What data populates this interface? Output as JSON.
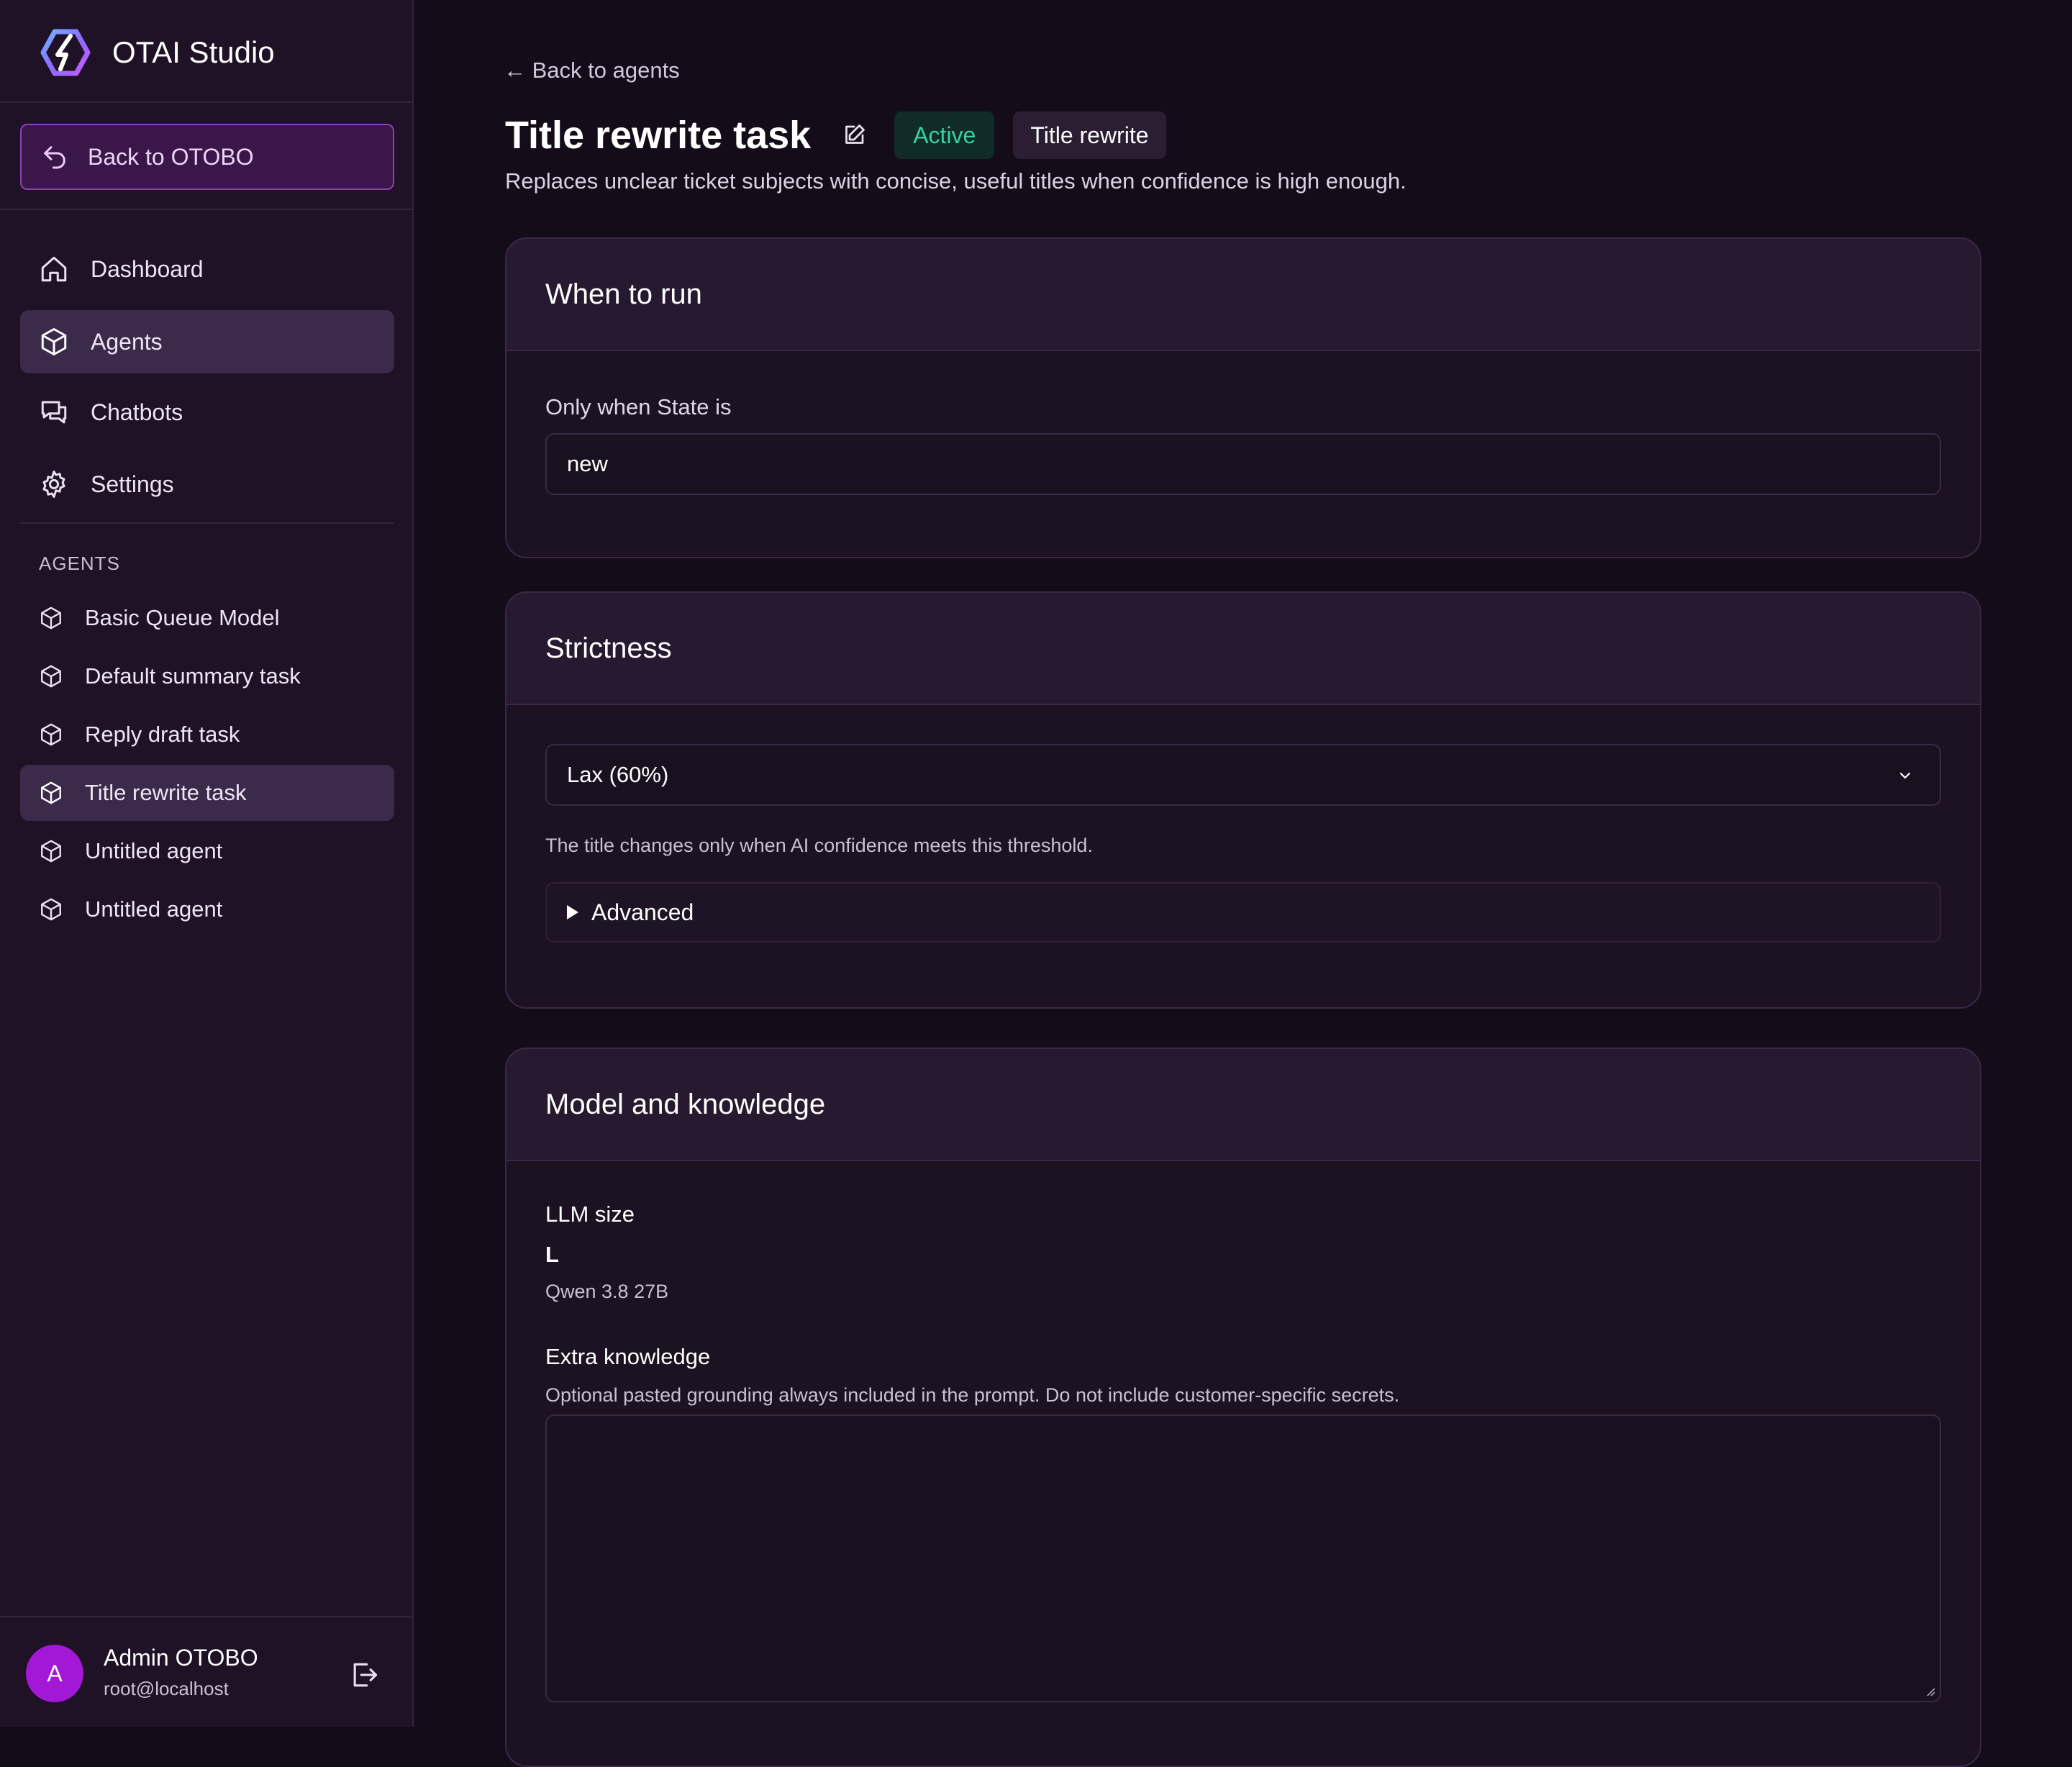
{
  "app": {
    "name": "OTAI Studio"
  },
  "sidebar": {
    "back_label": "Back to OTOBO",
    "nav": [
      {
        "label": "Dashboard",
        "icon": "home-icon"
      },
      {
        "label": "Agents",
        "icon": "cube-icon",
        "active": true
      },
      {
        "label": "Chatbots",
        "icon": "chat-icon"
      },
      {
        "label": "Settings",
        "icon": "gear-icon"
      }
    ],
    "agents_heading": "AGENTS",
    "agents": [
      {
        "label": "Basic Queue Model"
      },
      {
        "label": "Default summary task"
      },
      {
        "label": "Reply draft task"
      },
      {
        "label": "Title rewrite task",
        "active": true
      },
      {
        "label": "Untitled agent"
      },
      {
        "label": "Untitled agent"
      }
    ],
    "user": {
      "initial": "A",
      "name": "Admin OTOBO",
      "email": "root@localhost"
    }
  },
  "main": {
    "back_link": "← Back to agents",
    "title": "Title rewrite task",
    "status_badge": "Active",
    "type_badge": "Title rewrite",
    "description": "Replaces unclear ticket subjects with concise, useful titles when confidence is high enough.",
    "when_to_run": {
      "heading": "When to run",
      "state_label": "Only when State is",
      "state_value": "new"
    },
    "strictness": {
      "heading": "Strictness",
      "selected": "Lax (60%)",
      "helper": "The title changes only when AI confidence meets this threshold.",
      "advanced_label": "Advanced"
    },
    "model": {
      "heading": "Model and knowledge",
      "llm_label": "LLM size",
      "llm_size": "L",
      "llm_model": "Qwen 3.8 27B",
      "knowledge_label": "Extra knowledge",
      "knowledge_helper": "Optional pasted grounding always included in the prompt. Do not include customer-specific secrets.",
      "knowledge_value": ""
    }
  },
  "colors": {
    "background": "#150c1a",
    "sidebar": "#1f1226",
    "accent": "#a218d6",
    "active_green": "#35d3a1"
  }
}
